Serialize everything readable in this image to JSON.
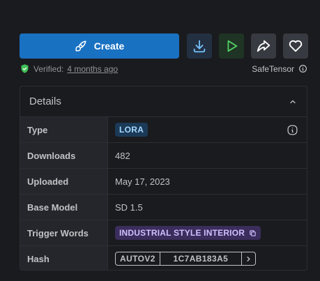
{
  "actions": {
    "create_label": "Create"
  },
  "verification": {
    "prefix": "Verified:",
    "time": "4 months ago",
    "safetensor": "SafeTensor"
  },
  "details": {
    "title": "Details",
    "rows": {
      "type": {
        "label": "Type",
        "value": "LORA"
      },
      "downloads": {
        "label": "Downloads",
        "value": "482"
      },
      "uploaded": {
        "label": "Uploaded",
        "value": "May 17, 2023"
      },
      "base_model": {
        "label": "Base Model",
        "value": "SD 1.5"
      },
      "trigger_words": {
        "label": "Trigger Words",
        "value": "INDUSTRIAL STYLE INTERIOR"
      },
      "hash": {
        "label": "Hash",
        "algo": "AUTOV2",
        "value": "1C7AB183A5"
      }
    }
  },
  "colors": {
    "primary": "#1971c2",
    "verified_green": "#40c057",
    "lora_badge": "#1b3a57",
    "trigger_badge": "#3b2d5c"
  }
}
